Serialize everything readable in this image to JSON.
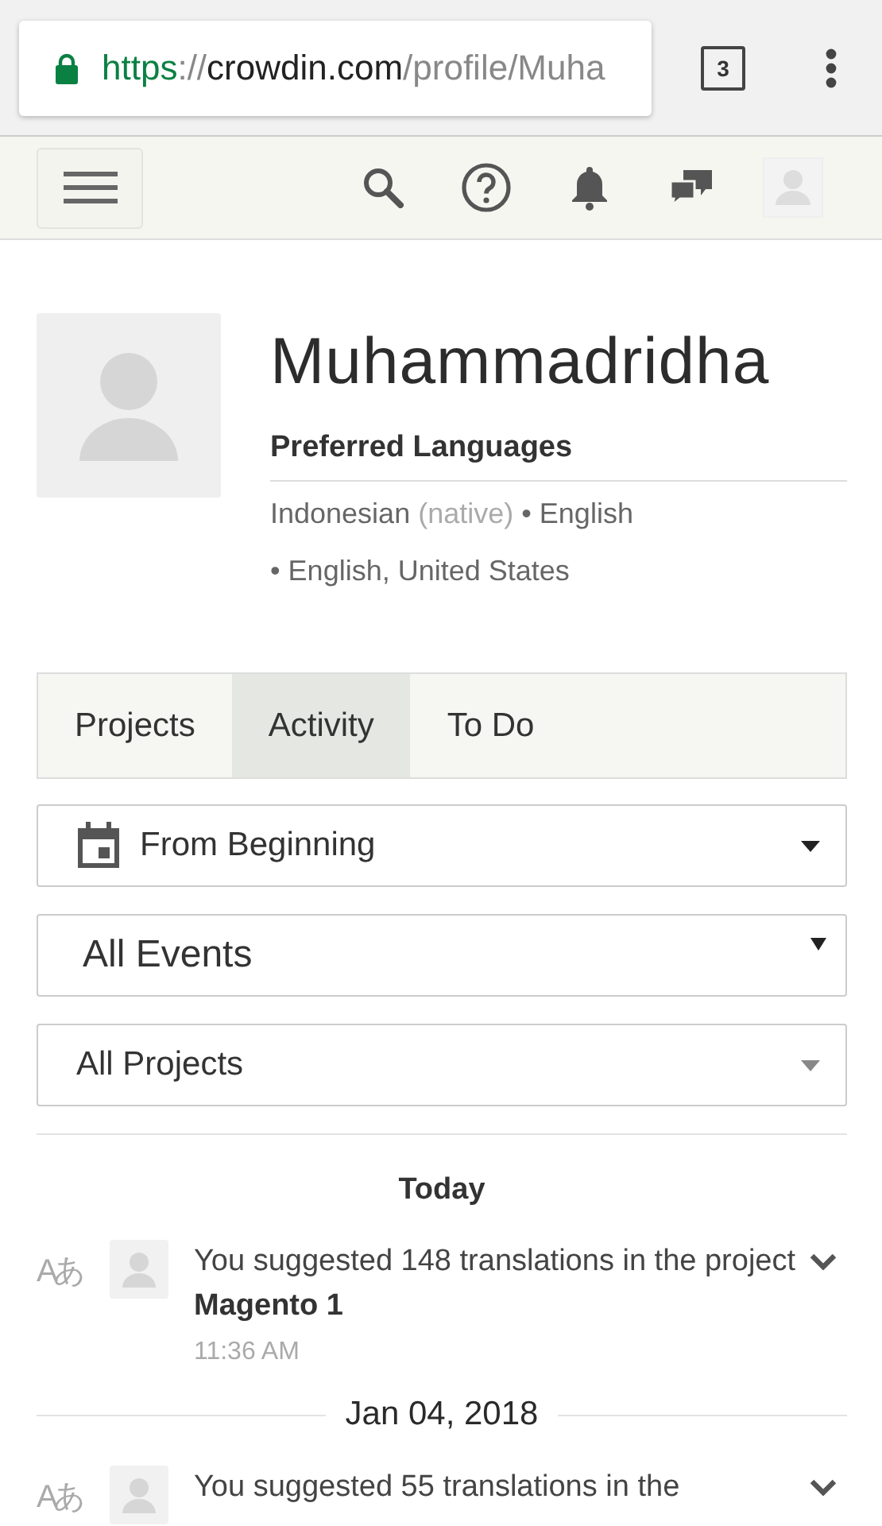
{
  "browser": {
    "url": [
      {
        "text": "https",
        "kind": "scheme"
      },
      {
        "text": "://",
        "kind": "muted"
      },
      {
        "text": "crowdin.com",
        "kind": "host"
      },
      {
        "text": "/profile/Muha",
        "kind": "muted"
      }
    ],
    "tab_count": "3"
  },
  "profile": {
    "name": "Muhammadridha",
    "languages_title": "Preferred Languages",
    "languages": [
      {
        "name": "Indonesian",
        "note": "(native)"
      },
      {
        "name": "• English"
      },
      {
        "name": "• English, United States"
      }
    ]
  },
  "tabs": [
    {
      "label": "Projects",
      "selected": false
    },
    {
      "label": "Activity",
      "selected": true
    },
    {
      "label": "To Do",
      "selected": false
    }
  ],
  "filters": [
    {
      "value": "From Beginning",
      "kind": "date"
    },
    {
      "value": "All Events",
      "kind": "native"
    },
    {
      "value": "All Projects",
      "kind": "plain"
    }
  ],
  "feed": [
    {
      "date": "Today",
      "kind": "plain",
      "items": [
        {
          "icon": "Aあ",
          "text": "You suggested 148 translations in the project **Magento 1**",
          "time": "11:36 AM"
        }
      ]
    },
    {
      "date": "Jan 04, 2018",
      "kind": "ruled",
      "items": [
        {
          "icon": "Aあ",
          "text": "You suggested 55 translations in the"
        }
      ]
    }
  ]
}
